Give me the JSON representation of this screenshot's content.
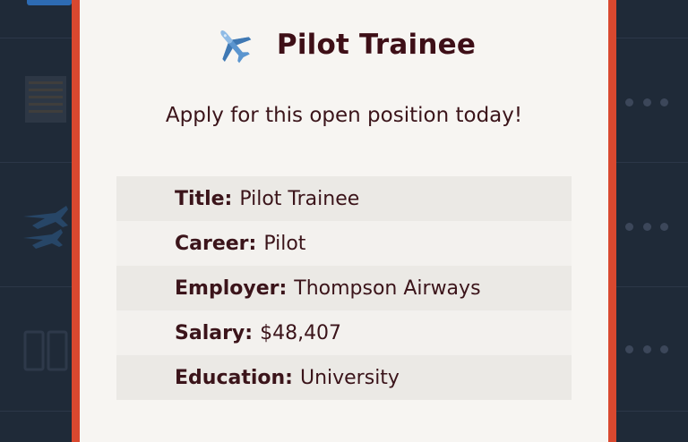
{
  "modal": {
    "icon": "airplane-icon",
    "title": "Pilot Trainee",
    "subtitle": "Apply for this open position today!",
    "details": [
      {
        "label": "Title:",
        "value": "Pilot Trainee"
      },
      {
        "label": "Career:",
        "value": "Pilot"
      },
      {
        "label": "Employer:",
        "value": "Thompson Airways"
      },
      {
        "label": "Salary:",
        "value": "$48,407"
      },
      {
        "label": "Education:",
        "value": "University"
      }
    ]
  },
  "colors": {
    "modal_border": "#d9482f",
    "modal_background": "#f7f5f2",
    "text": "#3b141a",
    "title": "#3e0f17",
    "backdrop": "#1f2a38"
  }
}
